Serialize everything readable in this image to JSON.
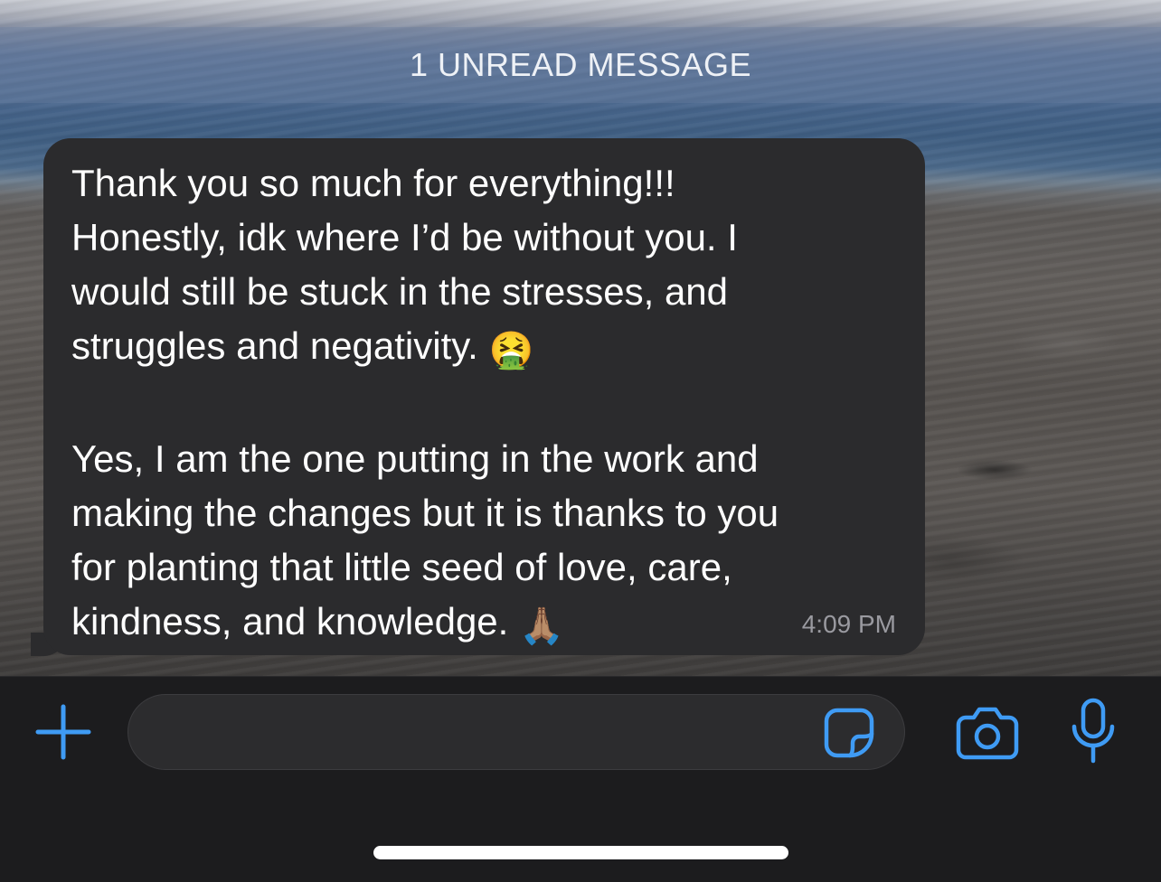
{
  "chat": {
    "unread_banner": "1 UNREAD MESSAGE",
    "message": {
      "paragraph_1": "Thank you so much for everything!!!\nHonestly, idk where I’d be without you. I\nwould still be stuck in the stresses, and\nstruggles and negativity.",
      "emoji_1": "🤮",
      "paragraph_2": "Yes, I am the one putting in the work and\nmaking the changes but it is thanks to you\nfor planting that little seed of love, care,\nkindness, and knowledge.",
      "emoji_2": "🙏🏽",
      "time": "4:09 PM"
    }
  },
  "composer": {
    "input_value": "",
    "icons": {
      "add": "plus-icon",
      "sticker": "sticker-icon",
      "camera": "camera-icon",
      "mic": "microphone-icon"
    }
  },
  "colors": {
    "accent": "#3f9bf4",
    "bubble": "#2b2b2d",
    "composer_bg": "#1c1c1e"
  }
}
